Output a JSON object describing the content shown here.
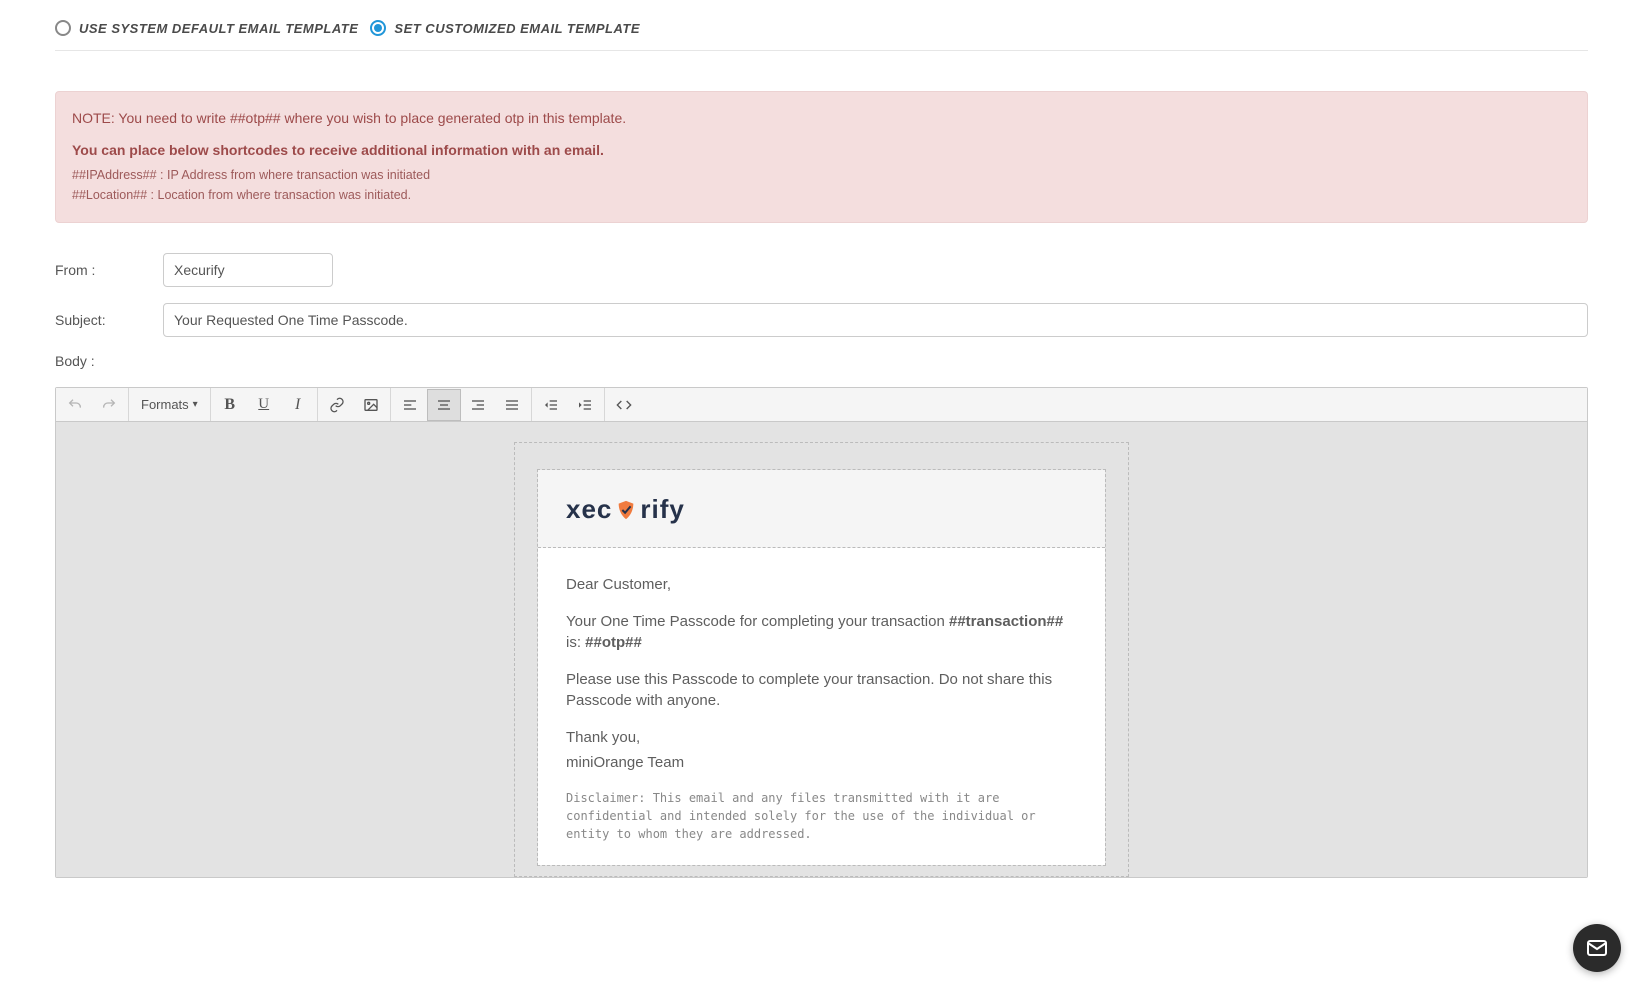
{
  "template_choice": {
    "default_label": "USE SYSTEM DEFAULT EMAIL TEMPLATE",
    "custom_label": "SET CUSTOMIZED EMAIL TEMPLATE",
    "selected": "custom"
  },
  "note": {
    "line1": "NOTE: You need to write ##otp## where you wish to place generated otp in this template.",
    "intro": "You can place below shortcodes to receive additional information with an email.",
    "sc1": "##IPAddress## : IP Address from where transaction was initiated",
    "sc2": "##Location## : Location from where transaction was initiated."
  },
  "form": {
    "from_label": "From :",
    "from_value": "Xecurify",
    "subject_label": "Subject:",
    "subject_value": "Your Requested One Time Passcode.",
    "body_label": "Body :"
  },
  "toolbar": {
    "formats": "Formats"
  },
  "email": {
    "logo_text_pre": "xec",
    "logo_text_post": "rify",
    "greeting": "Dear Customer,",
    "p2_pre": "Your One Time Passcode for completing your transaction ",
    "p2_bold1": "##transaction##",
    "p2_mid": " is: ",
    "p2_bold2": "##otp##",
    "p3": "Please use this Passcode to complete your transaction. Do not share this Passcode with anyone.",
    "p4a": "Thank you,",
    "p4b": "miniOrange Team",
    "disclaimer": "Disclaimer: This email and any files transmitted with it are confidential and intended solely for the use of the individual or entity to whom they are addressed."
  }
}
